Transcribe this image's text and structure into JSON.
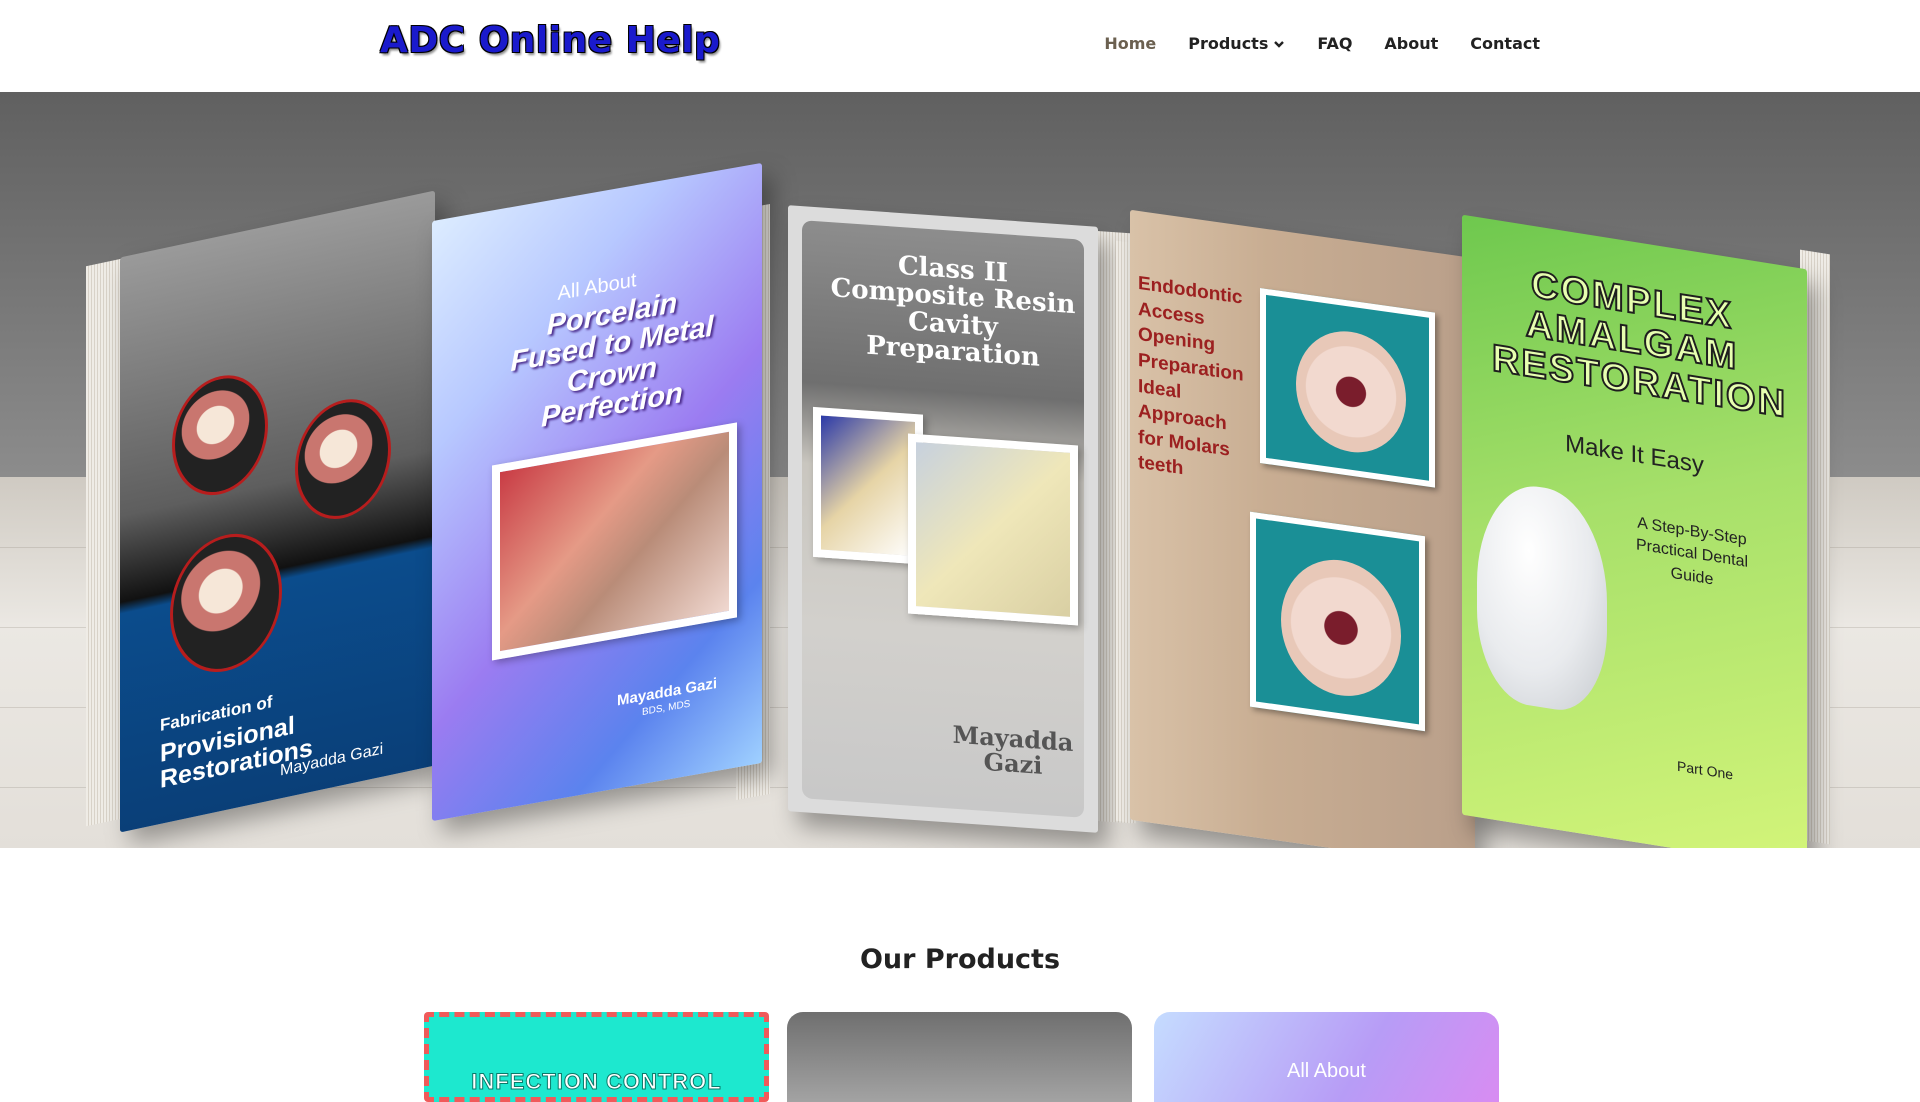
{
  "header": {
    "logo_text": "ADC Online Help",
    "nav": [
      {
        "label": "Home",
        "active": true
      },
      {
        "label": "Products",
        "has_dropdown": true
      },
      {
        "label": "FAQ"
      },
      {
        "label": "About"
      },
      {
        "label": "Contact"
      }
    ]
  },
  "hero": {
    "books": [
      {
        "title_top": "Fabrication of",
        "title": "Provisional Restorations",
        "author": "Mayadda Gazi"
      },
      {
        "title_top": "All About",
        "title": "Porcelain Fused to Metal Crown Perfection",
        "author": "Mayadda Gazi",
        "credentials": "BDS, MDS"
      },
      {
        "title": "Class II Composite Resin Cavity Preparation",
        "author": "Mayadda Gazi"
      },
      {
        "title": "Endodontic Access Opening Preparation Ideal Approach for Molars teeth"
      },
      {
        "title": "COMPLEX AMALGAM RESTORATION",
        "subtitle": "Make It Easy",
        "tagline": "A Step-By-Step Practical Dental Guide",
        "part": "Part One"
      }
    ]
  },
  "products": {
    "heading": "Our Products",
    "cards": [
      {
        "visible_text": "INFECTION CONTROL"
      },
      {
        "visible_text": ""
      },
      {
        "visible_text": "All About"
      }
    ]
  },
  "colors": {
    "logo": "#1a1acc",
    "nav_active": "#6b6050",
    "card1_bg": "#1de8cf",
    "card1_border": "#f05a5a"
  }
}
